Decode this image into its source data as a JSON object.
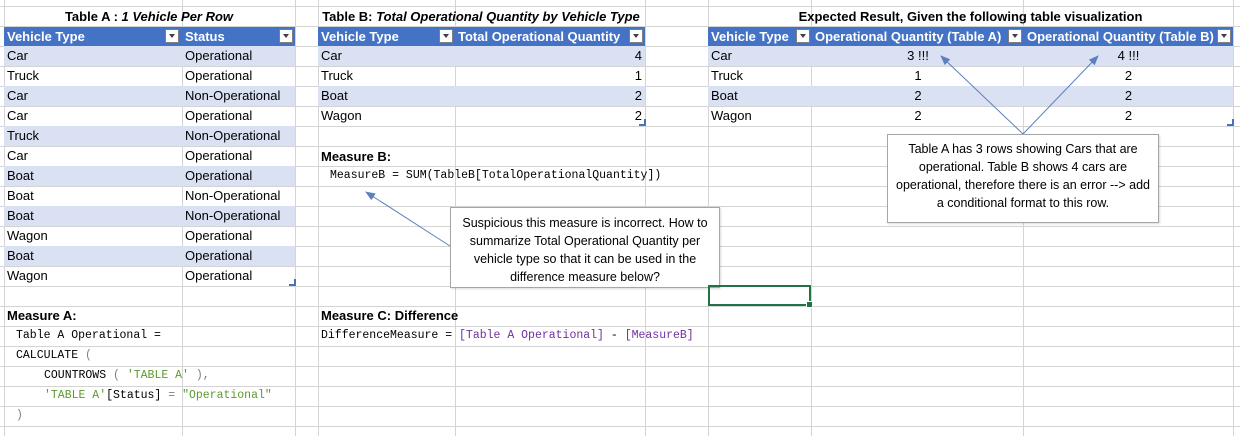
{
  "tableA": {
    "title_bold": "Table A : ",
    "title_italic": "1 Vehicle Per Row",
    "headers": [
      "Vehicle Type",
      "Status"
    ],
    "rows": [
      [
        "Car",
        "Operational"
      ],
      [
        "Truck",
        "Operational"
      ],
      [
        "Car",
        "Non-Operational"
      ],
      [
        "Car",
        "Operational"
      ],
      [
        "Truck",
        "Non-Operational"
      ],
      [
        "Car",
        "Operational"
      ],
      [
        "Boat",
        "Operational"
      ],
      [
        "Boat",
        "Non-Operational"
      ],
      [
        "Boat",
        "Non-Operational"
      ],
      [
        "Wagon",
        "Operational"
      ],
      [
        "Boat",
        "Operational"
      ],
      [
        "Wagon",
        "Operational"
      ]
    ]
  },
  "tableB": {
    "title_bold": "Table B: ",
    "title_italic": "Total Operational Quantity by Vehicle Type",
    "headers": [
      "Vehicle Type",
      "Total Operational Quantity"
    ],
    "rows": [
      [
        "Car",
        "4"
      ],
      [
        "Truck",
        "1"
      ],
      [
        "Boat",
        "2"
      ],
      [
        "Wagon",
        "2"
      ]
    ]
  },
  "expected": {
    "title": "Expected Result, Given the following table visualization",
    "headers": [
      "Vehicle Type",
      "Operational Quantity (Table A)",
      "Operational Quantity (Table B)"
    ],
    "rows": [
      [
        "Car",
        "3 !!!",
        "4 !!!"
      ],
      [
        "Truck",
        "1",
        "2"
      ],
      [
        "Boat",
        "2",
        "2"
      ],
      [
        "Wagon",
        "2",
        "2"
      ]
    ]
  },
  "measureB": {
    "label": "Measure B:",
    "code": "MeasureB = SUM(TableB[TotalOperationalQuantity])"
  },
  "measureA": {
    "label": "Measure A:",
    "line1": "Table A Operational =",
    "line2_kw": "CALCULATE",
    "line2_paren": " (",
    "line3_fn": "COUNTROWS",
    "line3_open": " ( ",
    "line3_tbl": "'TABLE A'",
    "line3_close": " ),",
    "line4_tbl": "'TABLE A'",
    "line4_col": "[Status]",
    "line4_eq": " = ",
    "line4_val": "\"Operational\"",
    "line5": ")"
  },
  "measureC": {
    "label": "Measure C: Difference",
    "code_name": "DifferenceMeasure = ",
    "code_ref1": "[Table A Operational]",
    "code_minus": " - ",
    "code_ref2": "[MeasureB]"
  },
  "callout1": {
    "text": "Suspicious this measure is incorrect. How to summarize Total Operational Quantity per vehicle type so that it can be used in the difference measure below?"
  },
  "callout2": {
    "text": "Table A has 3 rows showing Cars that are operational. Table B shows 4 cars are operational, therefore there is an error --> add a conditional format to this row."
  },
  "colors": {
    "header_bg": "#4472c4",
    "band_bg": "#d9e1f2",
    "gridline": "#d4d4d4",
    "dax_purple": "#7030a0",
    "dax_green": "#5b9b2e",
    "selection": "#217346"
  }
}
